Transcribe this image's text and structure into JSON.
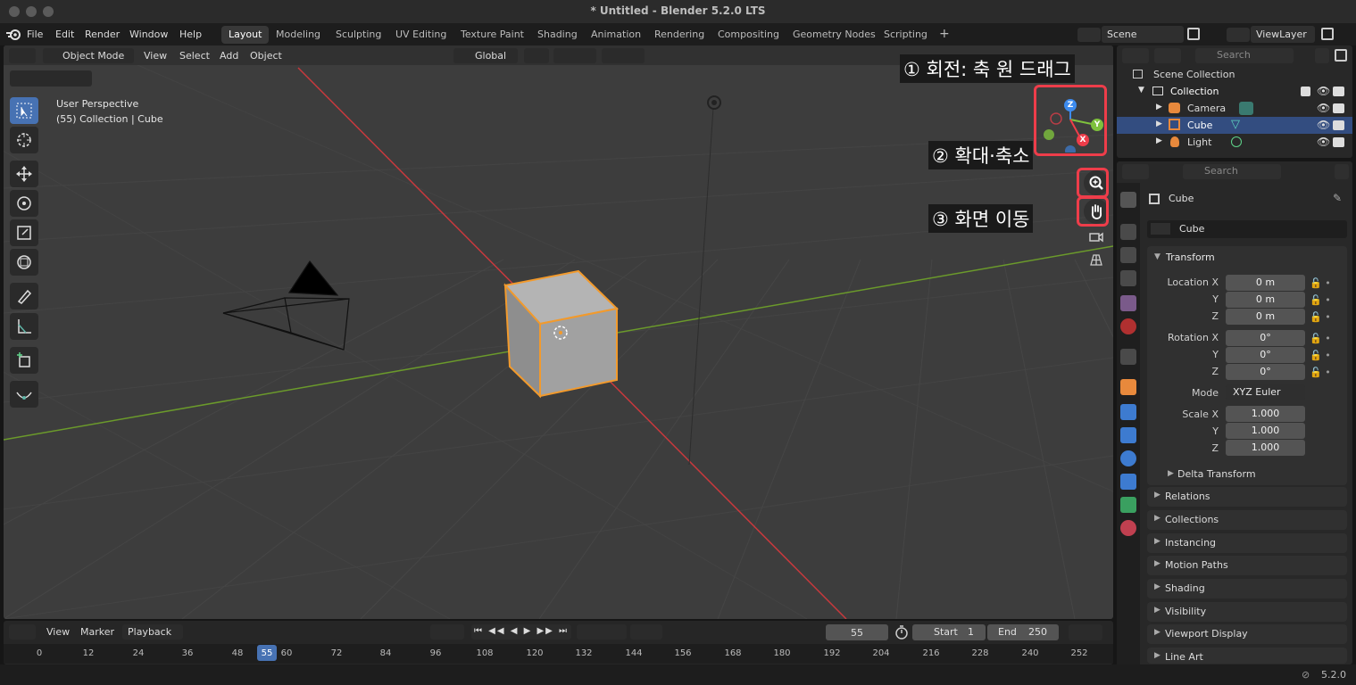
{
  "window": {
    "title": "* Untitled - Blender 5.2.0 LTS"
  },
  "menu": [
    "File",
    "Edit",
    "Render",
    "Window",
    "Help"
  ],
  "workspaces": [
    "Layout",
    "Modeling",
    "Sculpting",
    "UV Editing",
    "Texture Paint",
    "Shading",
    "Animation",
    "Rendering",
    "Compositing",
    "Geometry Nodes",
    "Scripting"
  ],
  "workspace_add": "+",
  "scene": {
    "name": "Scene",
    "view_layer": "ViewLayer"
  },
  "viewport": {
    "mode": "Object Mode",
    "menus": [
      "View",
      "Select",
      "Add",
      "Object"
    ],
    "orientation": "Global",
    "perspective_label": "User Perspective",
    "collection_label": "(55) Collection | Cube",
    "gizmo_axes": {
      "z": "Z",
      "y": "Y",
      "x": "X"
    }
  },
  "annotations": [
    {
      "text": "① 회전: 축 원 드래그"
    },
    {
      "text": "② 확대·축소"
    },
    {
      "text": "③ 화면 이동"
    }
  ],
  "timeline": {
    "menus": [
      "View",
      "Marker",
      "Playback"
    ],
    "current_frame": "55",
    "start_label": "Start",
    "start": "1",
    "end_label": "End",
    "end": "250",
    "ticks": [
      "0",
      "12",
      "24",
      "36",
      "48",
      "55",
      "60",
      "72",
      "84",
      "96",
      "108",
      "120",
      "132",
      "144",
      "156",
      "168",
      "180",
      "192",
      "204",
      "216",
      "228",
      "240",
      "252"
    ]
  },
  "outliner": {
    "search_placeholder": "Search",
    "root": "Scene Collection",
    "items": [
      {
        "label": "Collection"
      },
      {
        "label": "Camera"
      },
      {
        "label": "Cube"
      },
      {
        "label": "Light"
      }
    ]
  },
  "properties": {
    "search_placeholder": "Search",
    "object_name": "Cube",
    "data_name": "Cube",
    "transform_title": "Transform",
    "location_label": "Location X",
    "y_label": "Y",
    "z_label": "Z",
    "rotation_label": "Rotation X",
    "mode_label": "Mode",
    "scale_label": "Scale X",
    "location": [
      "0 m",
      "0 m",
      "0 m"
    ],
    "rotation": [
      "0°",
      "0°",
      "0°"
    ],
    "mode": "XYZ Euler",
    "scale": [
      "1.000",
      "1.000",
      "1.000"
    ],
    "delta_transform": "Delta Transform",
    "panels": [
      "Relations",
      "Collections",
      "Instancing",
      "Motion Paths",
      "Shading",
      "Visibility",
      "Viewport Display",
      "Line Art"
    ]
  },
  "status": {
    "version": "5.2.0"
  },
  "colors": {
    "accent": "#4772b3",
    "selection": "#ee9a3b",
    "annotation": "#ee3d4a",
    "x_axis": "#ee3d4a",
    "y_axis": "#7ec13d",
    "z_axis": "#3d8bee"
  }
}
